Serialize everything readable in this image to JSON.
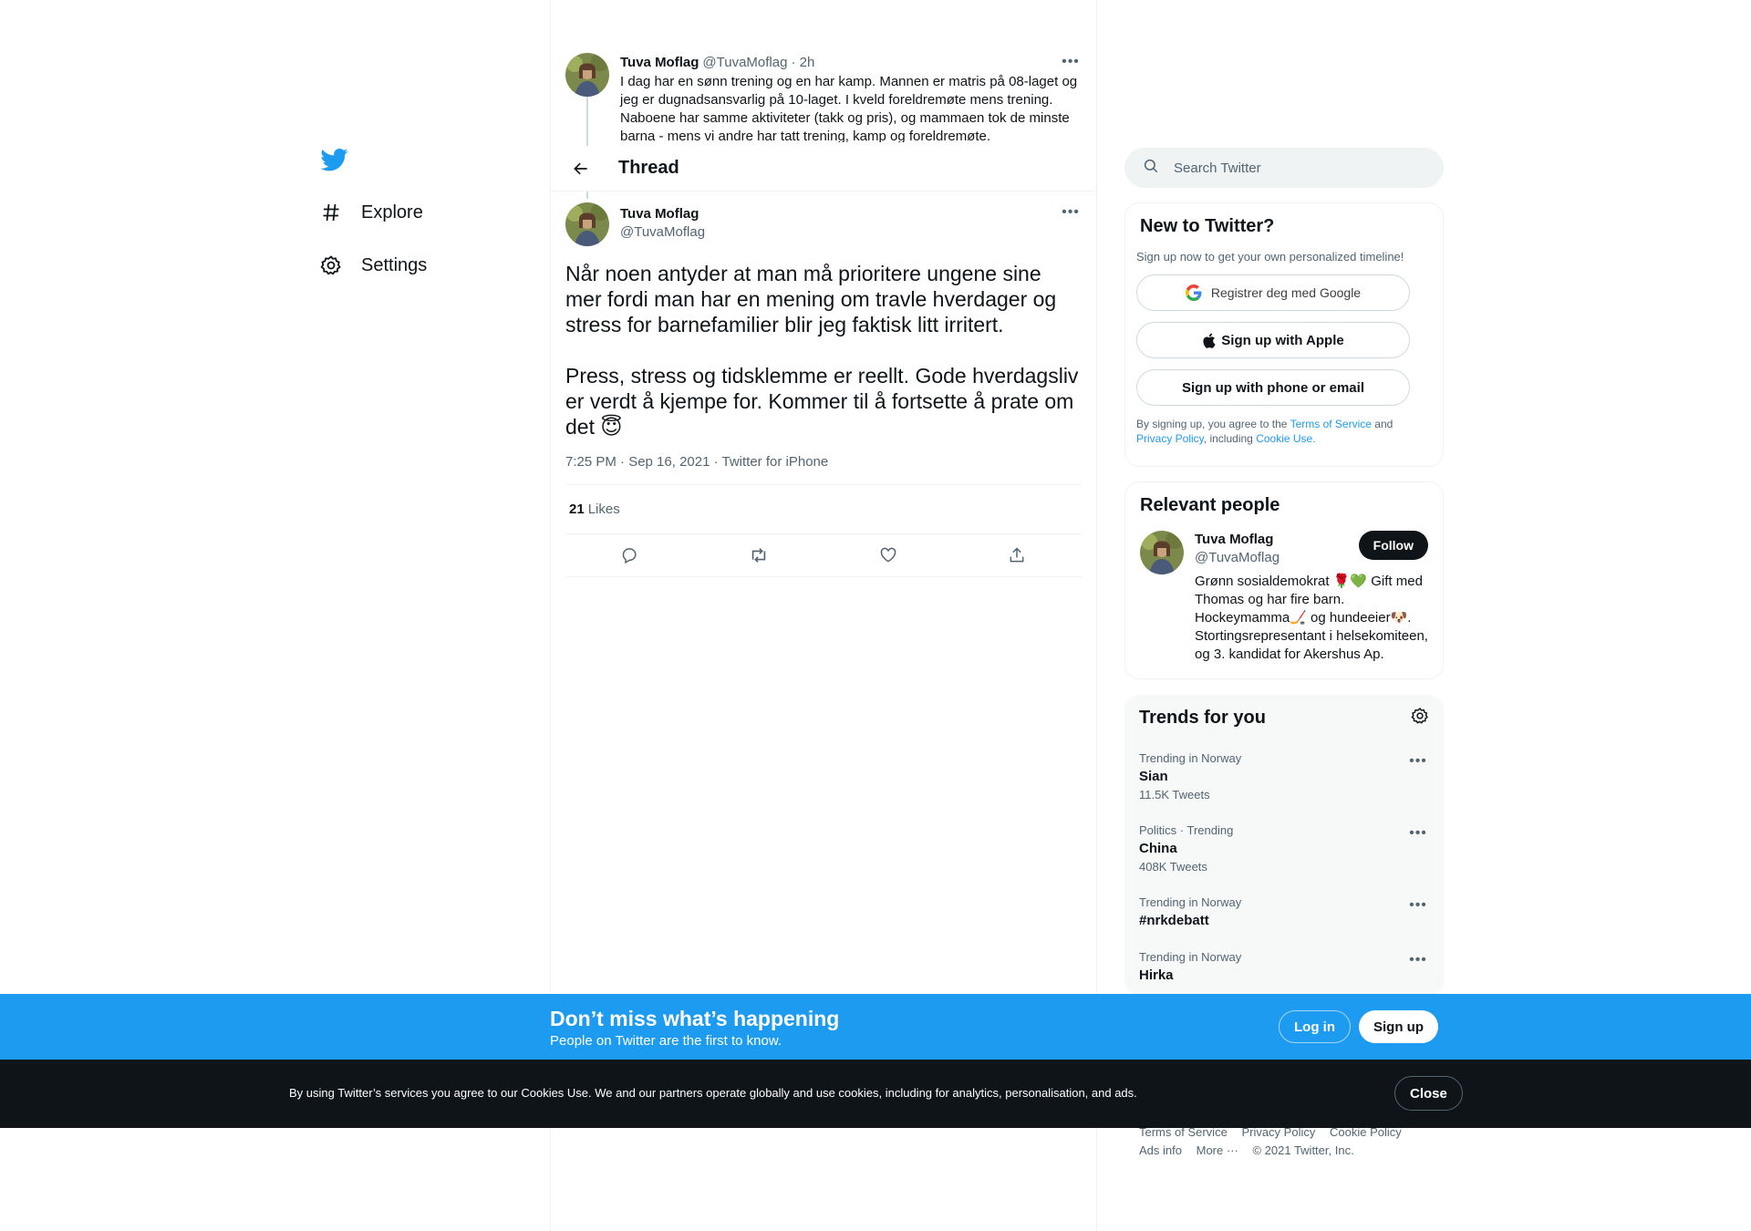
{
  "sidebar": {
    "items": [
      {
        "label": "Explore",
        "icon": "hashtag-icon"
      },
      {
        "label": "Settings",
        "icon": "gear-icon"
      }
    ]
  },
  "parent_tweet": {
    "name": "Tuva Moflag",
    "handle": "@TuvaMoflag",
    "time": "· 2h",
    "text": "I dag har en sønn trening og en har kamp. Mannen er matris på 08-laget og jeg er dugnadsansvarlig på 10-laget. I kveld foreldremøte mens trening. Naboene har samme aktiviteter (takk og pris), og mammaen tok de minste barna - mens vi andre har tatt trening, kamp og foreldremøte."
  },
  "header": {
    "title": "Thread"
  },
  "tweet": {
    "name": "Tuva Moflag",
    "handle": "@TuvaMoflag",
    "text": "Når noen antyder at man må prioritere ungene sine mer fordi man har en mening om travle hverdager og stress for barnefamilier blir jeg faktisk litt irritert.\n\nPress, stress og tidsklemme er reellt. Gode hverdagsliv er verdt å kjempe for. Kommer til å fortsette å prate om det 😇",
    "meta": "7:25 PM · Sep 16, 2021 · Twitter for iPhone",
    "likes_count": "21",
    "likes_label": "Likes"
  },
  "search": {
    "placeholder": "Search Twitter"
  },
  "new_to_twitter": {
    "title": "New to Twitter?",
    "subtitle": "Sign up now to get your own personalized timeline!",
    "google_label": "Registrer deg med Google",
    "apple_label": "Sign up with Apple",
    "phone_label": "Sign up with phone or email",
    "legal_prefix": "By signing up, you agree to the",
    "terms_link": "Terms of Service",
    "legal_and": "and",
    "privacy_link": "Privacy Policy",
    "legal_including": ", including",
    "cookie_link": "Cookie Use."
  },
  "relevant_people": {
    "title": "Relevant people",
    "name": "Tuva Moflag",
    "handle": "@TuvaMoflag",
    "follow_label": "Follow",
    "bio": "Grønn sosialdemokrat 🌹💚 Gift med Thomas og har fire barn. Hockeymamma🏒 og hundeeier🐶. Stortingsrepresentant i helsekomiteen, og 3. kandidat for Akershus Ap."
  },
  "trends": {
    "title": "Trends for you",
    "items": [
      {
        "meta": "Trending in Norway",
        "name": "Sian",
        "count": "11.5K Tweets"
      },
      {
        "meta": "Politics · Trending",
        "name": "China",
        "count": "408K Tweets"
      },
      {
        "meta": "Trending in Norway",
        "name": "#nrkdebatt",
        "count": ""
      },
      {
        "meta": "Trending in Norway",
        "name": "Hirka",
        "count": ""
      }
    ]
  },
  "footer": {
    "terms": "Terms of Service",
    "privacy": "Privacy Policy",
    "cookie": "Cookie Policy",
    "ads": "Ads info",
    "more": "More ···",
    "copyright": "© 2021 Twitter, Inc."
  },
  "signup_bar": {
    "title": "Don’t miss what’s happening",
    "subtitle": "People on Twitter are the first to know.",
    "login_label": "Log in",
    "signup_label": "Sign up"
  },
  "cookie_bar": {
    "text": "By using Twitter’s services you agree to our Cookies Use. We and our partners operate globally and use cookies, including for analytics, personalisation, and ads.",
    "close_label": "Close"
  },
  "colors": {
    "brand": "#1d9bf0",
    "text": "#0f1419",
    "secondary": "#536471",
    "cookie_bg": "#0f1419"
  }
}
